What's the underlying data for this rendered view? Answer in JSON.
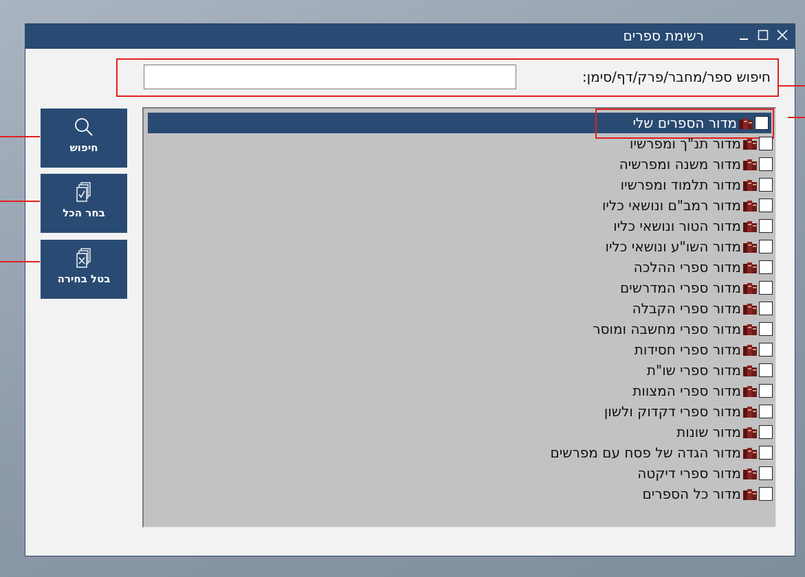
{
  "window": {
    "title": "רשימת ספרים"
  },
  "search": {
    "label": "חיפוש ספר/מחבר/פרק/דף/סימן:",
    "value": "",
    "placeholder": ""
  },
  "buttons": {
    "search": "חיפוש",
    "select_all": "בחר הכל",
    "clear_selection": "בטל בחירה"
  },
  "list": {
    "selected_index": 0,
    "items": [
      "מדור הספרים שלי",
      "מדור תנ\"ך ומפרשיו",
      "מדור משנה ומפרשיה",
      "מדור תלמוד ומפרשיו",
      "מדור רמב\"ם ונושאי כליו",
      "מדור הטור ונושאי כליו",
      "מדור השו\"ע ונושאי כליו",
      "מדור ספרי ההלכה",
      "מדור ספרי המדרשים",
      "מדור ספרי הקבלה",
      "מדור ספרי מחשבה ומוסר",
      "מדור ספרי חסידות",
      "מדור ספרי שו\"ת",
      "מדור ספרי המצוות",
      "מדור ספרי דקדוק ולשון",
      "מדור שונות",
      "מדור הגדה של פסח עם מפרשים",
      "מדור ספרי דיקטה",
      "מדור כל הספרים"
    ]
  },
  "colors": {
    "accent": "#294b73",
    "highlight": "#e02020",
    "list_bg": "#c2c2c2",
    "book_icon": "#7a1e1e"
  },
  "icons": {
    "titlebar": [
      "close-icon",
      "maximize-icon",
      "minimize-icon"
    ],
    "search_button": "magnifier-icon",
    "select_all_button": "documents-check-icon",
    "clear_button": "documents-x-icon",
    "list_item": "books-icon"
  }
}
